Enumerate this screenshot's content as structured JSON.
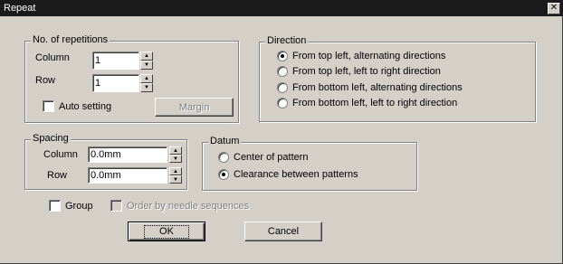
{
  "window": {
    "title": "Repeat",
    "close_glyph": "✕"
  },
  "repetitions": {
    "legend": "No. of repetitions",
    "column_label": "Column",
    "column_value": "1",
    "row_label": "Row",
    "row_value": "1",
    "auto_setting_label": "Auto setting",
    "auto_setting_checked": false,
    "margin_label": "Margin"
  },
  "direction": {
    "legend": "Direction",
    "options": [
      {
        "label": "From top left, alternating directions",
        "selected": true
      },
      {
        "label": "From top left, left to right direction",
        "selected": false
      },
      {
        "label": "From bottom left, alternating directions",
        "selected": false
      },
      {
        "label": "From bottom left, left to right direction",
        "selected": false
      }
    ]
  },
  "spacing": {
    "legend": "Spacing",
    "column_label": "Column",
    "column_value": "0.0mm",
    "row_label": "Row",
    "row_value": "0.0mm"
  },
  "datum": {
    "legend": "Datum",
    "options": [
      {
        "label": "Center of pattern",
        "selected": false
      },
      {
        "label": "Clearance between patterns",
        "selected": true
      }
    ]
  },
  "group_label": "Group",
  "order_label": "Order by needle sequences",
  "ok_label": "OK",
  "cancel_label": "Cancel",
  "icons": {
    "spin_up": "▲",
    "spin_down": "▼"
  }
}
